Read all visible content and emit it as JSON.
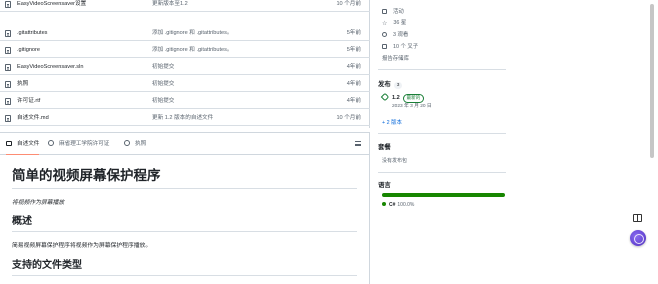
{
  "files": [
    {
      "name": "EasyVideoScreensaver设置",
      "message": "更新版本至1.2",
      "date": "10 个月前"
    },
    {
      "name": ".gitattributes",
      "message": "添加 .gitignore 和 .gitattributes。",
      "date": "5年前"
    },
    {
      "name": ".gitignore",
      "message": "添加 .gitignore 和 .gitattributes。",
      "date": "5年前"
    },
    {
      "name": "EasyVideoScreensaver.sln",
      "message": "初始提交",
      "date": "4年前"
    },
    {
      "name": "执照",
      "message": "初始提交",
      "date": "4年前"
    },
    {
      "name": "许可证.rtf",
      "message": "初始提交",
      "date": "4年前"
    },
    {
      "name": "自述文件.md",
      "message": "更新 1.2 版本的自述文件",
      "date": "10 个月前"
    }
  ],
  "readme": {
    "tabs": [
      {
        "label": "自述文件",
        "active": true
      },
      {
        "label": "麻省理工学院许可证",
        "active": false
      },
      {
        "label": "执照",
        "active": false
      }
    ],
    "title": "简单的视频屏幕保护程序",
    "tagline": "将视频作为屏幕播放",
    "h2_overview": "概述",
    "overview_text": "简易视频屏幕保护程序将视频作为屏幕保护程序播放。",
    "h2_formats": "支持的文件类型"
  },
  "sidebar": {
    "stats": [
      {
        "icon": "pulse-icon",
        "label": "活动"
      },
      {
        "icon": "star-icon",
        "label": "36 星"
      },
      {
        "icon": "eye-icon",
        "label": "3 观看"
      },
      {
        "icon": "fork-icon",
        "label": "10 个 叉子"
      }
    ],
    "report_label": "报告存储库",
    "releases_label": "发布",
    "releases_count": "3",
    "release_version": "1.2",
    "latest_badge": "最新的",
    "release_date": "2023 年 3 月 20 日",
    "more_tags": "+ 2 版本",
    "packages_label": "套餐",
    "no_packages": "没有发布包",
    "languages_label": "语言",
    "languages": [
      {
        "name": "C#",
        "percent": "100.0%",
        "color": "#178600"
      }
    ]
  },
  "colors": {
    "accent_tab": "#fd8c73",
    "link": "#0969da",
    "latest": "#1a7f37",
    "csharp": "#178600"
  }
}
